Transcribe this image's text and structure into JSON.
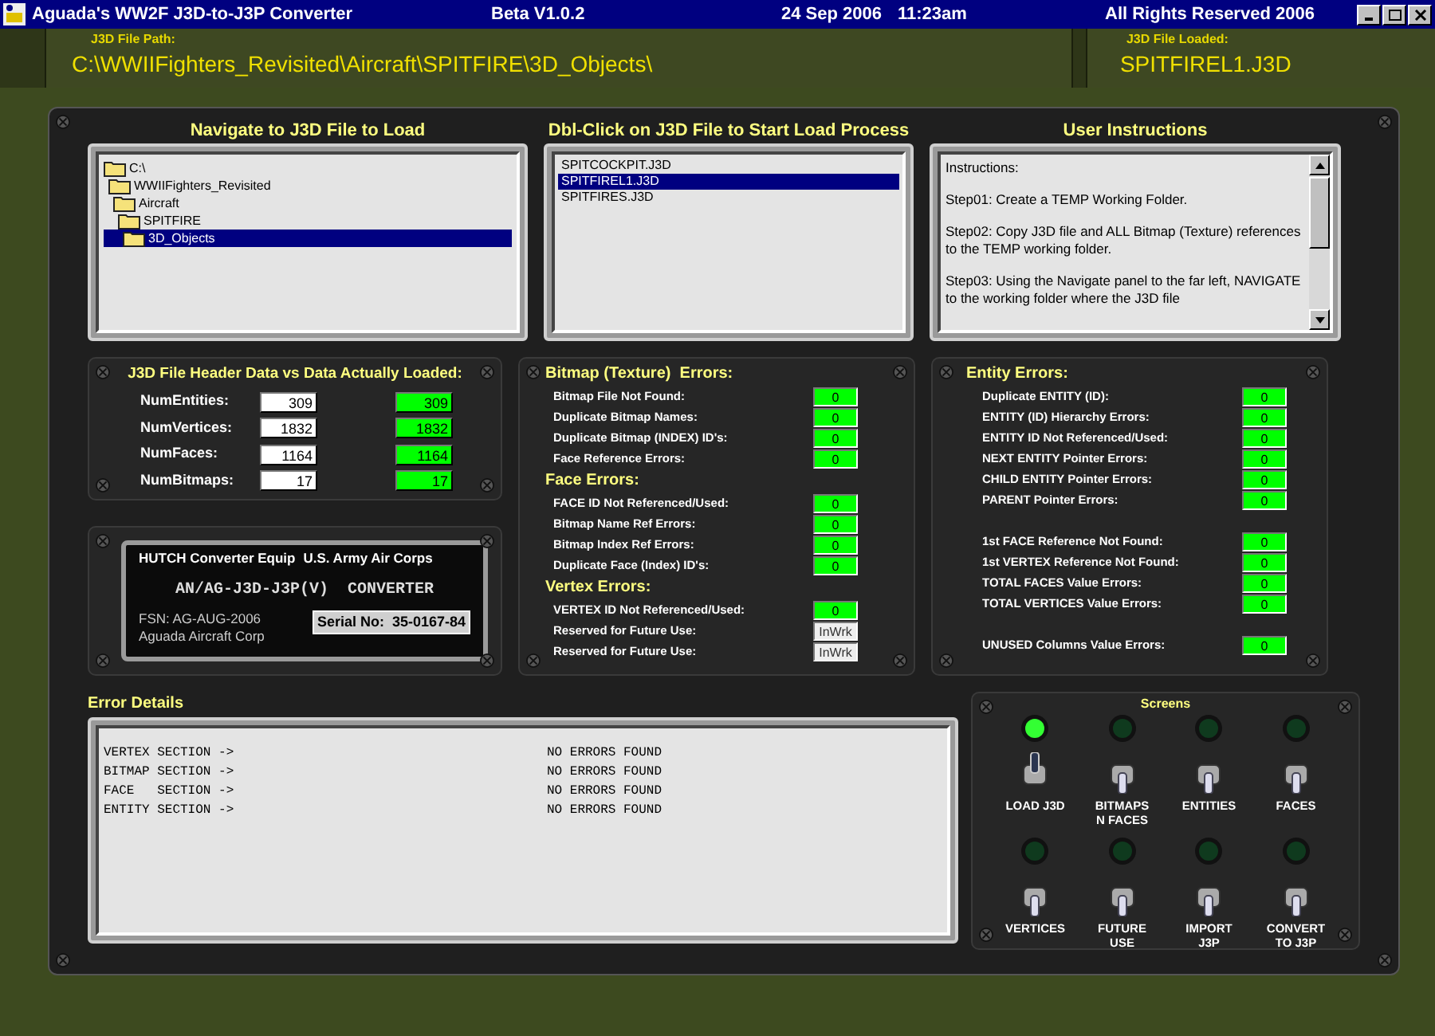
{
  "window": {
    "title": "Aguada's WW2F J3D-to-J3P Converter",
    "version": "Beta V1.0.2",
    "date": "24 Sep 2006",
    "time": "11:23am",
    "rights": "All Rights Reserved 2006"
  },
  "path_bar": {
    "label": "J3D File Path:",
    "value": "C:\\WWIIFighters_Revisited\\Aircraft\\SPITFIRE\\3D_Objects\\"
  },
  "loaded_bar": {
    "label": "J3D File Loaded:",
    "value": "SPITFIREL1.J3D"
  },
  "navigate": {
    "title": "Navigate to J3D File to Load",
    "folders": [
      {
        "name": "C:\\",
        "selected": false,
        "children": [
          {
            "name": "WWIIFighters_Revisited",
            "selected": false,
            "children": [
              {
                "name": "Aircraft",
                "selected": false,
                "children": [
                  {
                    "name": "SPITFIRE",
                    "selected": false,
                    "children": [
                      {
                        "name": "3D_Objects",
                        "selected": true
                      }
                    ]
                  }
                ]
              }
            ]
          }
        ]
      }
    ]
  },
  "files": {
    "title": "Dbl-Click on J3D File to Start Load Process",
    "items": [
      {
        "name": "SPITCOCKPIT.J3D",
        "selected": false
      },
      {
        "name": "SPITFIREL1.J3D",
        "selected": true
      },
      {
        "name": "SPITFIRES.J3D",
        "selected": false
      }
    ]
  },
  "instructions": {
    "title": "User Instructions",
    "paragraphs": [
      "Instructions:",
      "Step01: Create a TEMP Working Folder.",
      "Step02: Copy J3D file and ALL Bitmap (Texture) references to the TEMP working folder.",
      "Step03: Using the Navigate panel to the far left, NAVIGATE to the working folder where the J3D file"
    ]
  },
  "header_data": {
    "title": "J3D File Header Data vs Data Actually Loaded:",
    "rows": [
      {
        "label": "NumEntities:",
        "header": "309",
        "loaded": "309"
      },
      {
        "label": "NumVertices:",
        "header": "1832",
        "loaded": "1832"
      },
      {
        "label": "NumFaces:",
        "header": "1164",
        "loaded": "1164"
      },
      {
        "label": "NumBitmaps:",
        "header": "17",
        "loaded": "17"
      }
    ]
  },
  "plate": {
    "maker": "HUTCH Converter Equip",
    "branch": "U.S. Army Air Corps",
    "model": "AN/AG-J3D-J3P(V)  CONVERTER",
    "fsn": "FSN: AG-AUG-2006",
    "company": "Aguada Aircraft Corp",
    "serial": "Serial No:  35-0167-84"
  },
  "bitmap_panel": {
    "groups": [
      {
        "title": "Bitmap (Texture)  Errors:",
        "rows": [
          {
            "label": "Bitmap File Not Found:",
            "value": "0",
            "kind": "count"
          },
          {
            "label": "Duplicate Bitmap Names:",
            "value": "0",
            "kind": "count"
          },
          {
            "label": "Duplicate Bitmap (INDEX) ID's:",
            "value": "0",
            "kind": "count"
          },
          {
            "label": "Face Reference Errors:",
            "value": "0",
            "kind": "count"
          }
        ]
      },
      {
        "title": "Face Errors:",
        "rows": [
          {
            "label": "FACE ID Not Referenced/Used:",
            "value": "0",
            "kind": "count"
          },
          {
            "label": "Bitmap Name Ref Errors:",
            "value": "0",
            "kind": "count"
          },
          {
            "label": "Bitmap Index Ref Errors:",
            "value": "0",
            "kind": "count"
          },
          {
            "label": "Duplicate Face (Index) ID's:",
            "value": "0",
            "kind": "count"
          }
        ]
      },
      {
        "title": "Vertex Errors:",
        "rows": [
          {
            "label": "VERTEX ID Not Referenced/Used:",
            "value": "0",
            "kind": "count"
          },
          {
            "label": "Reserved for Future Use:",
            "value": "InWrk",
            "kind": "reserved"
          },
          {
            "label": "Reserved for Future Use:",
            "value": "InWrk",
            "kind": "reserved"
          }
        ]
      }
    ]
  },
  "entity_panel": {
    "title": "Entity Errors:",
    "groups": [
      [
        {
          "label": "Duplicate ENTITY (ID):",
          "value": "0"
        },
        {
          "label": "ENTITY (ID) Hierarchy Errors:",
          "value": "0"
        },
        {
          "label": "ENTITY ID Not Referenced/Used:",
          "value": "0"
        },
        {
          "label": "NEXT ENTITY Pointer Errors:",
          "value": "0"
        },
        {
          "label": "CHILD ENTITY Pointer Errors:",
          "value": "0"
        },
        {
          "label": "PARENT Pointer Errors:",
          "value": "0"
        }
      ],
      [
        {
          "label": "1st FACE Reference Not Found:",
          "value": "0"
        },
        {
          "label": "1st VERTEX Reference Not Found:",
          "value": "0"
        },
        {
          "label": "TOTAL FACES Value Errors:",
          "value": "0"
        },
        {
          "label": "TOTAL VERTICES Value Errors:",
          "value": "0"
        }
      ],
      [
        {
          "label": "UNUSED Columns Value Errors:",
          "value": "0"
        }
      ]
    ]
  },
  "error_details": {
    "title": "Error Details",
    "lines": [
      {
        "section": "VERTEX SECTION ->",
        "status": "NO ERRORS FOUND"
      },
      {
        "section": "BITMAP SECTION ->",
        "status": "NO ERRORS FOUND"
      },
      {
        "section": "FACE   SECTION ->",
        "status": "NO ERRORS FOUND"
      },
      {
        "section": "ENTITY SECTION ->",
        "status": "NO ERRORS FOUND"
      }
    ]
  },
  "screens": {
    "title": "Screens",
    "switches": [
      {
        "label": [
          "LOAD J3D"
        ],
        "on": true
      },
      {
        "label": [
          "BITMAPS",
          "N FACES"
        ],
        "on": false
      },
      {
        "label": [
          "ENTITIES"
        ],
        "on": false
      },
      {
        "label": [
          "FACES"
        ],
        "on": false
      },
      {
        "label": [
          "VERTICES"
        ],
        "on": false
      },
      {
        "label": [
          "FUTURE",
          "USE"
        ],
        "on": false
      },
      {
        "label": [
          "IMPORT",
          "J3P"
        ],
        "on": false
      },
      {
        "label": [
          "CONVERT",
          "TO J3P"
        ],
        "on": false
      }
    ]
  }
}
